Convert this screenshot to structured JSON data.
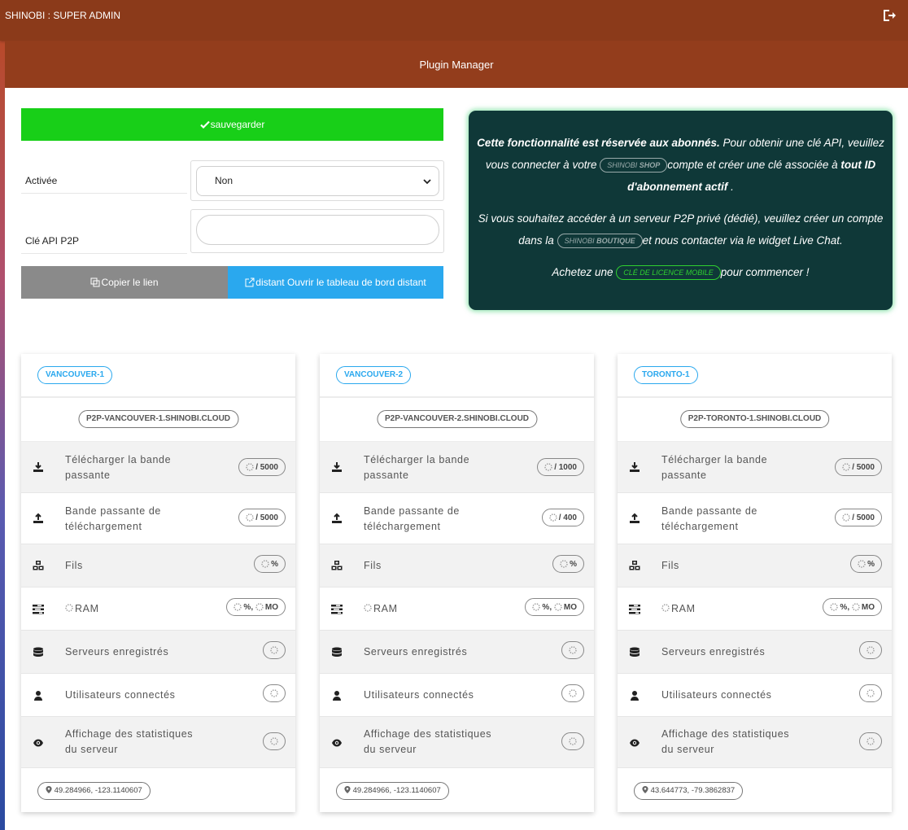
{
  "topbar": {
    "title": "SHINOBI : SUPER ADMIN"
  },
  "page": {
    "title": "Plugin Manager"
  },
  "form": {
    "save_label": "sauvegarder",
    "activated_label": "Activée",
    "activated_value": "Non",
    "api_key_label": "Clé API P2P",
    "api_key_value": "",
    "copy_link_label": "Copier le lien",
    "open_dashboard_label": "distant Ouvrir le tableau de bord distant"
  },
  "promo": {
    "p1_bold": "Cette fonctionnalité est réservée aux abonnés.",
    "p1_a": " Pour obtenir une clé API, veuillez vous connecter à votre ",
    "shop_a": "SHINOBI ",
    "shop_b": "SHOP",
    "p1_b": "compte et créer une clé associée à ",
    "p1_bold2": "tout ID d'abonnement actif",
    "p1_c": " .",
    "p2_a": "Si vous souhaitez accéder à un serveur P2P privé (dédié), veuillez créer un compte dans la ",
    "boutique_a": "SHINOBI ",
    "boutique_b": "BOUTIQUE",
    "p2_b": "et nous contacter via le widget Live Chat.",
    "p3_a": "Achetez une ",
    "license": "CLÉ DE LICENCE MOBILE",
    "p3_b": "pour commencer !"
  },
  "labels": {
    "download": "Télécharger la bande passante",
    "upload": "Bande passante de téléchargement",
    "threads": "Fils",
    "ram": "RAM",
    "servers": "Serveurs enregistrés",
    "users": "Utilisateurs connectés",
    "stats": "Affichage des statistiques du serveur",
    "pct": "%",
    "mo": "MO"
  },
  "servers": [
    {
      "name": "VANCOUVER-1",
      "host": "P2P-VANCOUVER-1.SHINOBI.CLOUD",
      "download_limit": "/ 5000",
      "upload_limit": "/ 5000",
      "geo": "49.284966, -123.1140607"
    },
    {
      "name": "VANCOUVER-2",
      "host": "P2P-VANCOUVER-2.SHINOBI.CLOUD",
      "download_limit": "/ 1000",
      "upload_limit": "/ 400",
      "geo": "49.284966, -123.1140607"
    },
    {
      "name": "TORONTO-1",
      "host": "P2P-TORONTO-1.SHINOBI.CLOUD",
      "download_limit": "/ 5000",
      "upload_limit": "/ 5000",
      "geo": "43.644773, -79.3862837"
    }
  ],
  "colors": {
    "topbar": "#8b3a1a",
    "subheader": "#933d1c",
    "save": "#18cf18",
    "copy": "#8a8a8a",
    "open": "#2aa8ee",
    "promo_bg": "#0f3838",
    "promo_glow": "#46d278",
    "tag_blue": "#2aa8ee"
  },
  "icons": {
    "logout": "sign-out-icon",
    "save": "check-icon",
    "copy": "copy-icon",
    "open": "external-link-icon",
    "download": "download-icon",
    "upload": "upload-icon",
    "threads": "cubes-icon",
    "ram": "tasks-icon",
    "servers": "database-icon",
    "users": "user-icon",
    "stats": "eye-icon",
    "geo": "map-marker-icon",
    "loading": "spinner-icon"
  }
}
